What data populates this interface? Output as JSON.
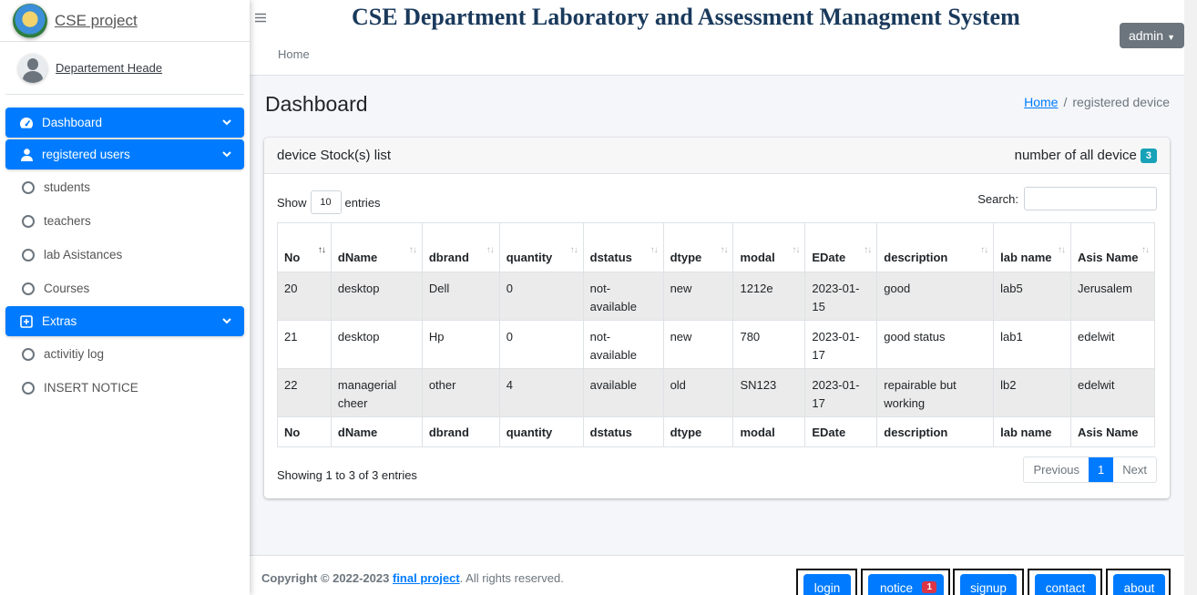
{
  "brand": {
    "title": "CSE project"
  },
  "user": {
    "name": "Departement Heade"
  },
  "sidebar": {
    "items": [
      {
        "label": "Dashboard",
        "type": "section"
      },
      {
        "label": "registered users",
        "type": "section"
      },
      {
        "label": "students",
        "type": "sub"
      },
      {
        "label": "teachers",
        "type": "sub"
      },
      {
        "label": "lab Asistances",
        "type": "sub"
      },
      {
        "label": "Courses",
        "type": "sub"
      },
      {
        "label": "Extras",
        "type": "section"
      },
      {
        "label": "activitiy log",
        "type": "sub"
      },
      {
        "label": "INSERT NOTICE",
        "type": "sub"
      }
    ]
  },
  "header": {
    "title": "CSE Department Laboratory and Assessment Managment System",
    "admin_label": "admin",
    "home_link": "Home"
  },
  "page": {
    "title": "Dashboard",
    "breadcrumb": {
      "home": "Home",
      "separator": "/",
      "current": "registered device"
    }
  },
  "card": {
    "title": "device Stock(s) list",
    "count_label": "number of all device",
    "count": "3"
  },
  "datatable": {
    "show_label": "Show",
    "length_value": "10",
    "entries_label": "entries",
    "search_label": "Search:",
    "search_value": "",
    "info": "Showing 1 to 3 of 3 entries",
    "pagination": {
      "previous": "Previous",
      "current": "1",
      "next": "Next"
    }
  },
  "table": {
    "headers": [
      "No",
      "dName",
      "dbrand",
      "quantity",
      "dstatus",
      "dtype",
      "modal",
      "EDate",
      "description",
      "lab name",
      "Asis Name"
    ],
    "rows": [
      [
        "20",
        "desktop",
        "Dell",
        "0",
        "not-available",
        "new",
        "1212e",
        "2023-01-15",
        "good",
        "lab5",
        "Jerusalem"
      ],
      [
        "21",
        "desktop",
        "Hp",
        "0",
        "not-available",
        "new",
        "780",
        "2023-01-17",
        "good status",
        "lab1",
        "edelwit"
      ],
      [
        "22",
        "managerial cheer",
        "other",
        "4",
        "available",
        "old",
        "SN123",
        "2023-01-17",
        "repairable but working",
        "lb2",
        "edelwit"
      ]
    ]
  },
  "footer": {
    "copyright_prefix": "Copyright © 2022-2023",
    "project_link": "final project",
    "copyright_suffix": ". All rights reserved.",
    "buttons": [
      "login",
      "notice",
      "signup",
      "contact",
      "about"
    ],
    "notice_badge": "1"
  },
  "colors": {
    "primary": "#007bff",
    "info": "#17a2b8",
    "danger": "#dc3545",
    "secondary": "#6c757d",
    "title": "#1a3a5c"
  }
}
